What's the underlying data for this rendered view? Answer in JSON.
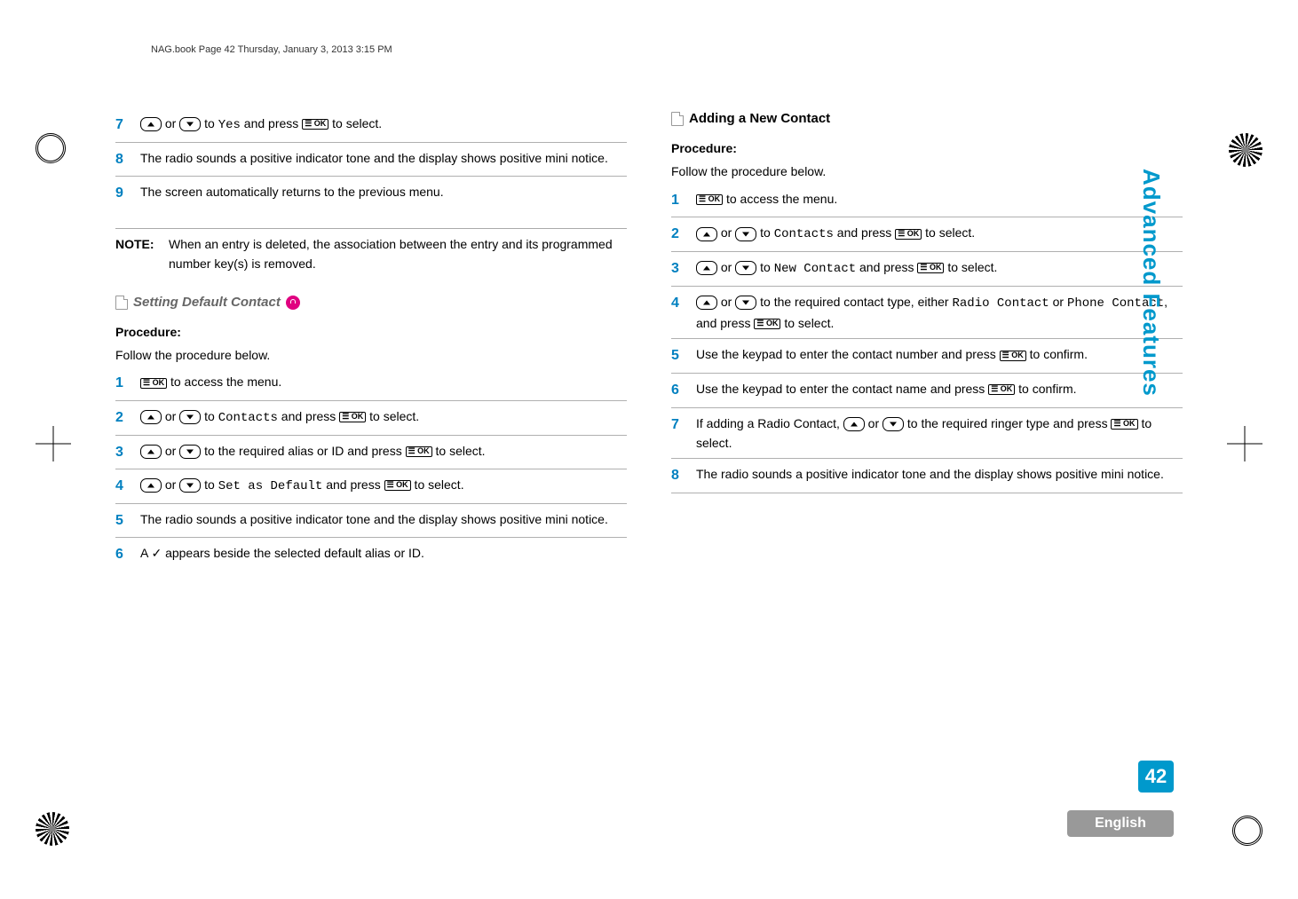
{
  "header": "NAG.book  Page 42  Thursday, January 3, 2013  3:15 PM",
  "sidebar": "Advanced Features",
  "page_number": "42",
  "language": "English",
  "ok_label": "☰ OK",
  "left": {
    "steps_top": [
      {
        "n": "7",
        "pre": "",
        "mid": " or ",
        "post1": " to ",
        "mono": "Yes",
        "post2": " and press ",
        "post3": " to select."
      },
      {
        "n": "8",
        "text": "The radio sounds a positive indicator tone and the display shows positive mini notice."
      },
      {
        "n": "9",
        "text": "The screen automatically returns to the previous menu."
      }
    ],
    "note_label": "NOTE:",
    "note_text": "When an entry is deleted, the association between the entry and its programmed number key(s) is removed.",
    "section_heading": "Setting Default Contact",
    "procedure_label": "Procedure:",
    "procedure_sub": "Follow the procedure below.",
    "steps_bottom": [
      {
        "n": "1",
        "post1": " to access the menu."
      },
      {
        "n": "2",
        "mid": " or ",
        "post1": " to ",
        "mono": "Contacts",
        "post2": " and press ",
        "post3": " to select."
      },
      {
        "n": "3",
        "mid": " or ",
        "post1": " to the required alias or ID and press ",
        "post3": " to select."
      },
      {
        "n": "4",
        "mid": " or ",
        "post1": " to ",
        "mono": "Set as Default",
        "post2": " and press ",
        "post3": " to select."
      },
      {
        "n": "5",
        "text": "The radio sounds a positive indicator tone and the display shows positive mini notice."
      },
      {
        "n": "6",
        "text": "A ✓ appears beside the selected default alias or ID."
      }
    ]
  },
  "right": {
    "section_heading": "Adding a New Contact",
    "procedure_label": "Procedure:",
    "procedure_sub": "Follow the procedure below.",
    "steps": [
      {
        "n": "1",
        "post1": " to access the menu."
      },
      {
        "n": "2",
        "mid": " or ",
        "post1": " to ",
        "mono": "Contacts",
        "post2": " and press ",
        "post3": " to select."
      },
      {
        "n": "3",
        "mid": " or ",
        "post1": " to ",
        "mono": "New Contact",
        "post2": " and press ",
        "post3": " to select."
      },
      {
        "n": "4",
        "mid": " or ",
        "post1": " to the required contact type, either ",
        "mono": "Radio Contact",
        "post2a": " or ",
        "mono2": "Phone Contact",
        "post2": ", and press ",
        "post3": " to select."
      },
      {
        "n": "5",
        "text_pre": "Use the keypad to enter the contact number and press ",
        "text_post": " to confirm."
      },
      {
        "n": "6",
        "text_pre": "Use the keypad to enter the contact name and press ",
        "text_post": " to confirm."
      },
      {
        "n": "7",
        "text_pre": "If adding a Radio Contact, ",
        "mid": " or ",
        "post1": " to the required ringer type and press ",
        "post3": " to select."
      },
      {
        "n": "8",
        "text": "The radio sounds a positive indicator tone and the display shows positive mini notice."
      }
    ]
  }
}
